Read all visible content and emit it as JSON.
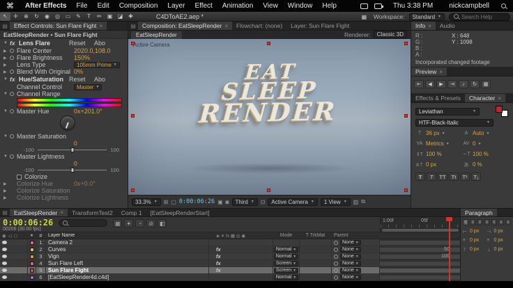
{
  "menubar": {
    "apple": "⌘",
    "items": [
      "After Effects",
      "File",
      "Edit",
      "Composition",
      "Layer",
      "Effect",
      "Animation",
      "View",
      "Window",
      "Help"
    ],
    "time": "Thu 3:38 PM",
    "user": "nickcampbell"
  },
  "toolbar": {
    "doc_title": "C4DToAE2.aep *",
    "workspace_label": "Workspace:",
    "workspace_value": "Standard",
    "search_placeholder": "Search Help"
  },
  "effect_controls": {
    "tab_title": "Effect Controls: Sun Flare Fight",
    "breadcrumb": "EatSleepRender • Sun Flare Fight",
    "lens_flare": {
      "name": "Lens Flare",
      "reset": "Reset",
      "about": "Abo",
      "flare_center_label": "Flare Center",
      "flare_center_value": "2020.0,108.0",
      "flare_brightness_label": "Flare Brightness",
      "flare_brightness_value": "150%",
      "lens_type_label": "Lens Type",
      "lens_type_value": "105mm Prime",
      "blend_label": "Blend With Original",
      "blend_value": "0%"
    },
    "hue_saturation": {
      "name": "Hue/Saturation",
      "reset": "Reset",
      "about": "Abo",
      "channel_control_label": "Channel Control",
      "channel_control_value": "Master",
      "channel_range_label": "Channel Range",
      "master_hue_label": "Master Hue",
      "master_hue_value": "0x+201.0°",
      "master_saturation_label": "Master Saturation",
      "master_saturation_value": "0",
      "master_lightness_label": "Master Lightness",
      "master_lightness_value": "0",
      "range_min": "-100",
      "range_max": "100",
      "colorize_label": "Colorize",
      "colorize_hue_label": "Colorize Hue",
      "colorize_hue_value": "0x+0.0°",
      "colorize_saturation_label": "Colorize Saturation",
      "colorize_lightness_label": "Colorize Lightness"
    }
  },
  "composition": {
    "tab_comp": "Composition: EatSleepRender",
    "tab_flowchart": "Flowchart: (none)",
    "tab_layer": "Layer: Sun Flare Fight",
    "comp_name_tab": "EatSleepRender",
    "renderer_label": "Renderer:",
    "renderer_value": "Classic 3D",
    "camera_label": "Active Camera",
    "art_lines": [
      "EAT",
      "SLEEP",
      "RENDER"
    ],
    "zoom": "33.3%",
    "timecode": "0:00:06:26",
    "resolution": "Third",
    "view_camera": "Active Camera",
    "view_count": "1 View"
  },
  "info": {
    "tab_info": "Info",
    "tab_audio": "Audio",
    "r": "R :",
    "g": "G :",
    "b": "B :",
    "a": "A :",
    "x": "X : 648",
    "y": "Y : 1098",
    "message": "Incorporated changed footage"
  },
  "preview": {
    "tab": "Preview"
  },
  "character": {
    "tab_effects": "Effects & Presets",
    "tab_character": "Character",
    "font": "Leviathan",
    "style": "HTF-Black-Italic",
    "size": "36 px",
    "leading": "Auto",
    "kerning": "Metrics",
    "tracking": "0",
    "vscale": "100 %",
    "hscale": "100 %",
    "baseline": "0 px",
    "tsume": "0 %",
    "style_buttons": [
      "T",
      "T",
      "TT",
      "Tt",
      "T¹",
      "T₁"
    ]
  },
  "paragraph": {
    "tab": "Paragraph",
    "fields": [
      "0 px",
      "0 px",
      "0 px",
      "0 px",
      "0 px",
      "0 px"
    ]
  },
  "timeline": {
    "tabs": [
      "EatSleepRender",
      "TransformTest2",
      "Comp 1",
      "[EatSleepRenderStart]"
    ],
    "timecode": "0:00:06:26",
    "frames": "00206 (30.00 fps)",
    "col_num": "#",
    "col_name": "Layer Name",
    "col_mode": "Mode",
    "col_trkmat": "T TrkMat",
    "col_parent": "Parent",
    "ruler": [
      "1:00f",
      "05f"
    ],
    "graph_labels": [
      "50",
      "100"
    ],
    "layers": [
      {
        "num": "1",
        "name": "Camera 2",
        "parent": "None",
        "color": "#e0608a"
      },
      {
        "num": "2",
        "name": "Curves",
        "mode": "Normal",
        "parent": "None",
        "color": "#d7c24a"
      },
      {
        "num": "3",
        "name": "Vign",
        "mode": "Normal",
        "parent": "None",
        "color": "#e09a3c"
      },
      {
        "num": "4",
        "name": "Sun Flare Left",
        "mode": "Screen",
        "parent": "None",
        "color": "#e0608a"
      },
      {
        "num": "5",
        "name": "Sun Flare Fight",
        "mode": "Screen",
        "parent": "None",
        "color": "#d04545"
      },
      {
        "num": "6",
        "name": "[EatSleepRender4d.c4d]",
        "mode": "Normal",
        "parent": "None",
        "color": "#9a6ad0"
      }
    ]
  }
}
